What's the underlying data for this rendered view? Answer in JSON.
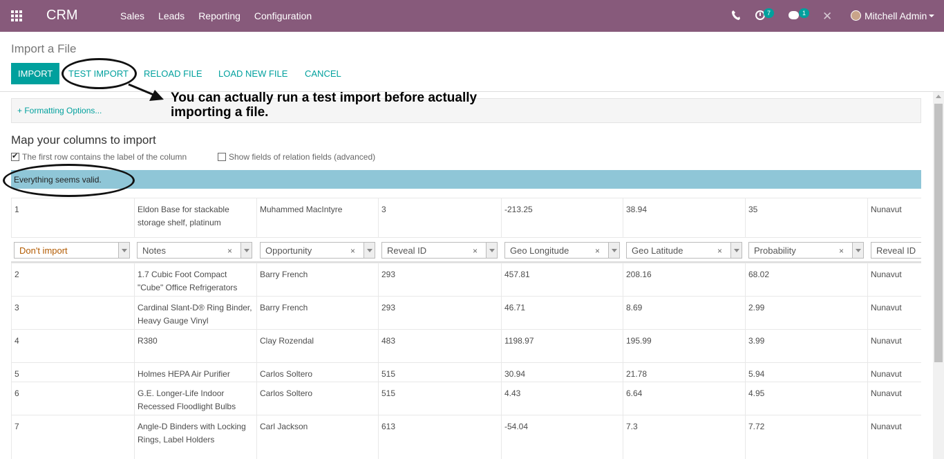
{
  "navbar": {
    "brand": "CRM",
    "menu": [
      "Sales",
      "Leads",
      "Reporting",
      "Configuration"
    ],
    "activity_count": "7",
    "message_count": "1",
    "user_name": "Mitchell Admin"
  },
  "page": {
    "title": "Import a File",
    "buttons": {
      "import": "IMPORT",
      "test_import": "TEST IMPORT",
      "reload_file": "RELOAD FILE",
      "load_new_file": "LOAD NEW FILE",
      "cancel": "CANCEL"
    },
    "callout": "You can actually run a test import before actually importing a file.",
    "formatting_options": "+ Formatting Options...",
    "map_title": "Map your columns to import",
    "first_row_label": "The first row contains the label of the column",
    "show_relation_label": "Show fields of relation fields (advanced)",
    "valid_message": "Everything seems valid."
  },
  "header_row": [
    "1",
    "Eldon Base for stackable storage shelf, platinum",
    "Muhammed MacIntyre",
    "3",
    "-213.25",
    "38.94",
    "35",
    "Nunavut"
  ],
  "mappings": [
    "Don't import",
    "Notes",
    "Opportunity",
    "Reveal ID",
    "Geo Longitude",
    "Geo Latitude",
    "Probability",
    "Reveal ID"
  ],
  "rows": [
    [
      "2",
      "1.7 Cubic Foot Compact \"Cube\" Office Refrigerators",
      "Barry French",
      "293",
      "457.81",
      "208.16",
      "68.02",
      "Nunavut"
    ],
    [
      "3",
      "Cardinal Slant-D® Ring Binder, Heavy Gauge Vinyl",
      "Barry French",
      "293",
      "46.71",
      "8.69",
      "2.99",
      "Nunavut"
    ],
    [
      "4",
      "R380",
      "Clay Rozendal",
      "483",
      "1198.97",
      "195.99",
      "3.99",
      "Nunavut"
    ],
    [
      "5",
      "Holmes HEPA Air Purifier",
      "Carlos Soltero",
      "515",
      "30.94",
      "21.78",
      "5.94",
      "Nunavut"
    ],
    [
      "6",
      "G.E. Longer-Life Indoor Recessed Floodlight Bulbs",
      "Carlos Soltero",
      "515",
      "4.43",
      "6.64",
      "4.95",
      "Nunavut"
    ],
    [
      "7",
      "Angle-D Binders with Locking Rings, Label Holders",
      "Carl Jackson",
      "613",
      "-54.04",
      "7.3",
      "7.72",
      "Nunavut"
    ]
  ],
  "colors": {
    "navbar": "#875a7b",
    "primary": "#00a09d",
    "valid_bg": "#8fc6d7"
  }
}
